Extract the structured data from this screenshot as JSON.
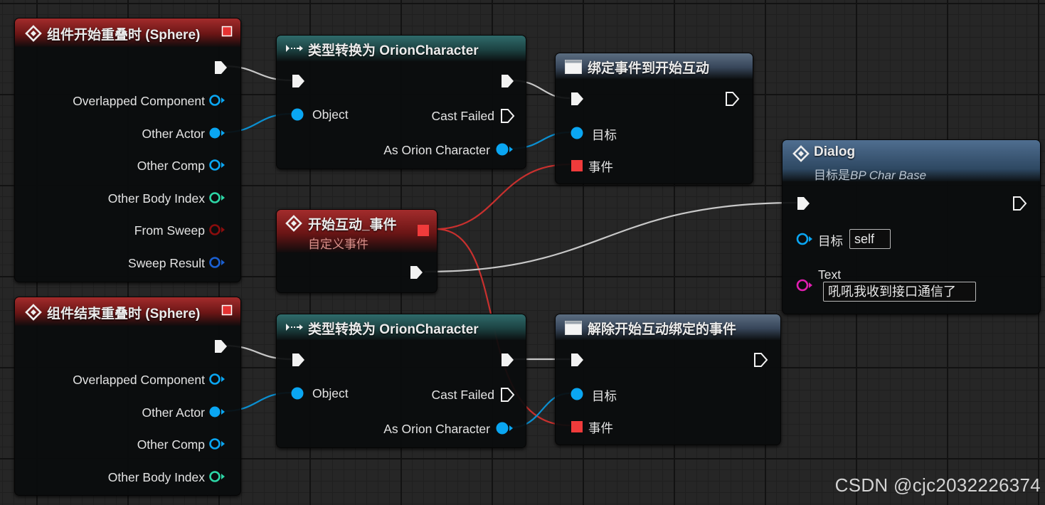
{
  "colors": {
    "exec": "#f2f2f2",
    "object_pin": "#0aa6f2",
    "struct_pin": "#1a5fd1",
    "int_pin": "#2dd6a6",
    "bool_pin": "#8a0d0d",
    "delegate_pin": "#f03b3b",
    "text_pin": "#e11eb0",
    "event_wire": "#c8302e",
    "object_wire": "#0b8fd0",
    "exec_wire": "#c8c8c8"
  },
  "nodes": {
    "begin_overlap": {
      "title": "组件开始重叠时 (Sphere)",
      "icon": "event-diamond-icon",
      "outputs": [
        "Overlapped Component",
        "Other Actor",
        "Other Comp",
        "Other Body Index",
        "From Sweep",
        "Sweep Result"
      ]
    },
    "end_overlap": {
      "title": "组件结束重叠时 (Sphere)",
      "icon": "event-diamond-icon",
      "outputs": [
        "Overlapped Component",
        "Other Actor",
        "Other Comp",
        "Other Body Index"
      ]
    },
    "cast_top": {
      "title": "类型转换为 OrionCharacter",
      "icon": "cast-arrow-icon",
      "input_object": "Object",
      "cast_failed": "Cast Failed",
      "as_output": "As Orion Character"
    },
    "cast_bottom": {
      "title": "类型转换为 OrionCharacter",
      "icon": "cast-arrow-icon",
      "input_object": "Object",
      "cast_failed": "Cast Failed",
      "as_output": "As Orion Character"
    },
    "bind_event": {
      "title": "绑定事件到开始互动",
      "icon": "function-window-icon",
      "target": "目标",
      "event": "事件"
    },
    "unbind_event": {
      "title": "解除开始互动绑定的事件",
      "icon": "function-window-icon",
      "target": "目标",
      "event": "事件"
    },
    "custom_event": {
      "title": "开始互动_事件",
      "subtitle": "自定义事件",
      "icon": "event-diamond-icon"
    },
    "dialog": {
      "title": "Dialog",
      "subtitle_prefix": "目标是",
      "subtitle_class": "BP Char Base",
      "icon": "function-diamond-icon",
      "target_label": "目标",
      "target_value": "self",
      "text_label": "Text",
      "text_value": "吼吼我收到接口通信了"
    }
  },
  "watermark": "CSDN @cjc2032226374"
}
